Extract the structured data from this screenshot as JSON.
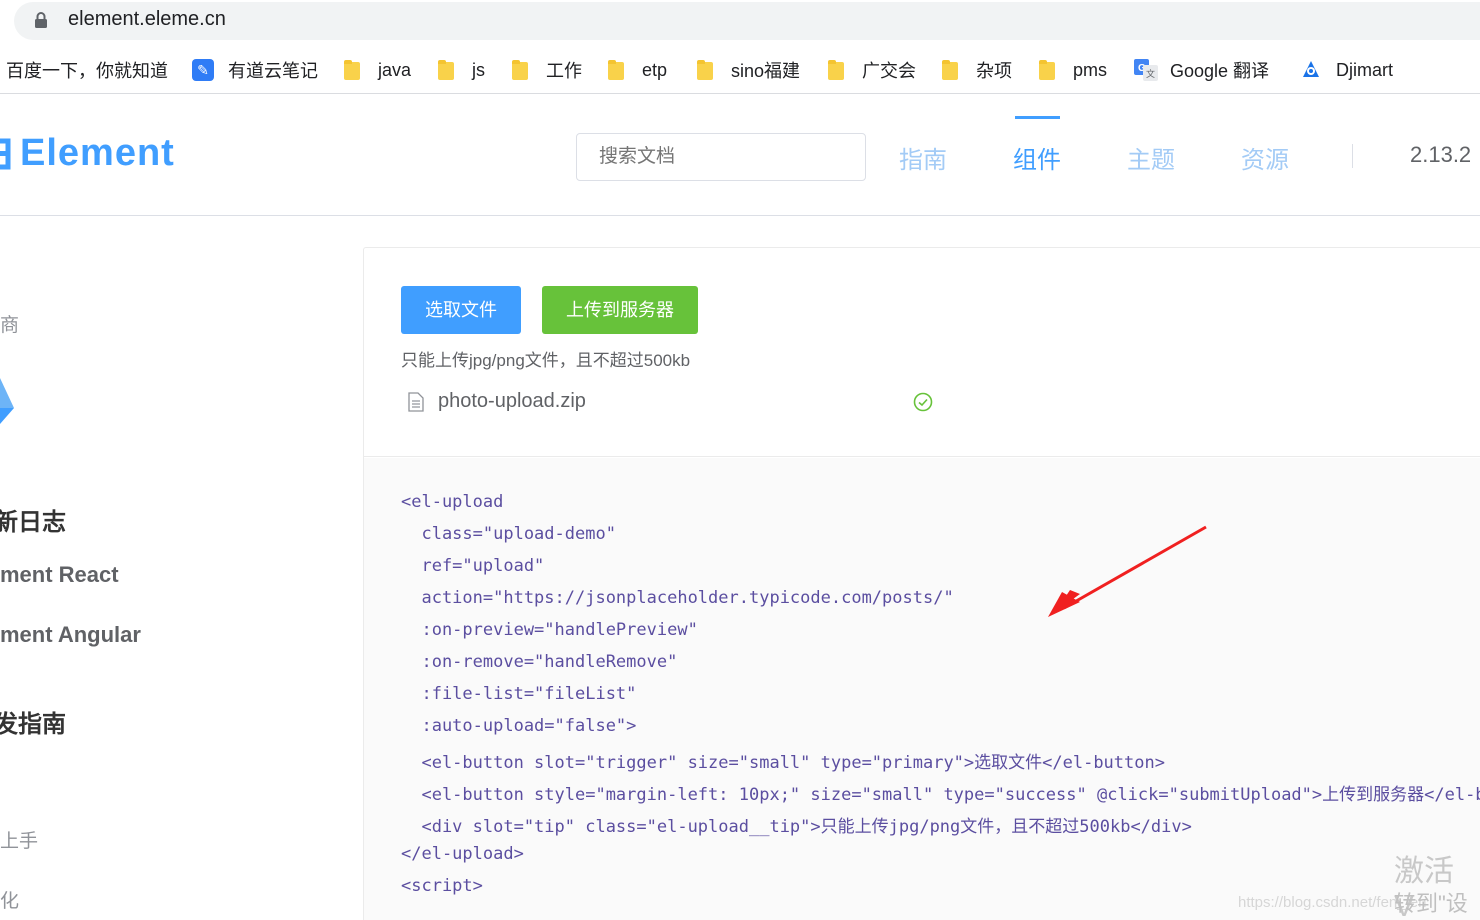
{
  "browser": {
    "url": "element.eleme.cn",
    "bookmarks": [
      {
        "label": "百度一下，你就知道",
        "icon": "none"
      },
      {
        "label": "有道云笔记",
        "icon": "note-icon"
      },
      {
        "label": "java",
        "icon": "folder-icon"
      },
      {
        "label": "js",
        "icon": "folder-icon"
      },
      {
        "label": "工作",
        "icon": "folder-icon"
      },
      {
        "label": "etp",
        "icon": "folder-icon"
      },
      {
        "label": "sino福建",
        "icon": "folder-icon"
      },
      {
        "label": "广交会",
        "icon": "folder-icon"
      },
      {
        "label": "杂项",
        "icon": "folder-icon"
      },
      {
        "label": "pms",
        "icon": "folder-icon"
      },
      {
        "label": "Google 翻译",
        "icon": "google-translate-icon"
      },
      {
        "label": "Djimart",
        "icon": "djimart-icon"
      }
    ]
  },
  "header": {
    "logo_text": "Element",
    "search_placeholder": "搜索文档",
    "nav": [
      "指南",
      "组件",
      "主题",
      "资源"
    ],
    "active_nav": "组件",
    "version": "2.13.2"
  },
  "sidebar": {
    "items": [
      "商",
      "新日志",
      "ment React",
      "ment Angular",
      "发指南",
      "上手",
      "化"
    ]
  },
  "demo": {
    "select_button": "选取文件",
    "upload_button": "上传到服务器",
    "tip": "只能上传jpg/png文件，且不超过500kb",
    "file_name": "photo-upload.zip"
  },
  "code": {
    "lines": [
      "<el-upload",
      "  class=\"upload-demo\"",
      "  ref=\"upload\"",
      "  action=\"https://jsonplaceholder.typicode.com/posts/\"",
      "  :on-preview=\"handlePreview\"",
      "  :on-remove=\"handleRemove\"",
      "  :file-list=\"fileList\"",
      "  :auto-upload=\"false\">",
      "  <el-button slot=\"trigger\" size=\"small\" type=\"primary\">选取文件</el-button>",
      "  <el-button style=\"margin-left: 10px;\" size=\"small\" type=\"success\" @click=\"submitUpload\">上传到服务器</el-but",
      "  <div slot=\"tip\" class=\"el-upload__tip\">只能上传jpg/png文件，且不超过500kb</div>",
      "</el-upload>",
      "<script>"
    ]
  },
  "watermark": {
    "activate": "激活 V",
    "goto": "转到\"设置",
    "blog": "https://blog.csdn.net/fen_fen"
  },
  "colors": {
    "brand": "#409eff",
    "success": "#67c23a",
    "annotation_arrow": "#f02020"
  }
}
